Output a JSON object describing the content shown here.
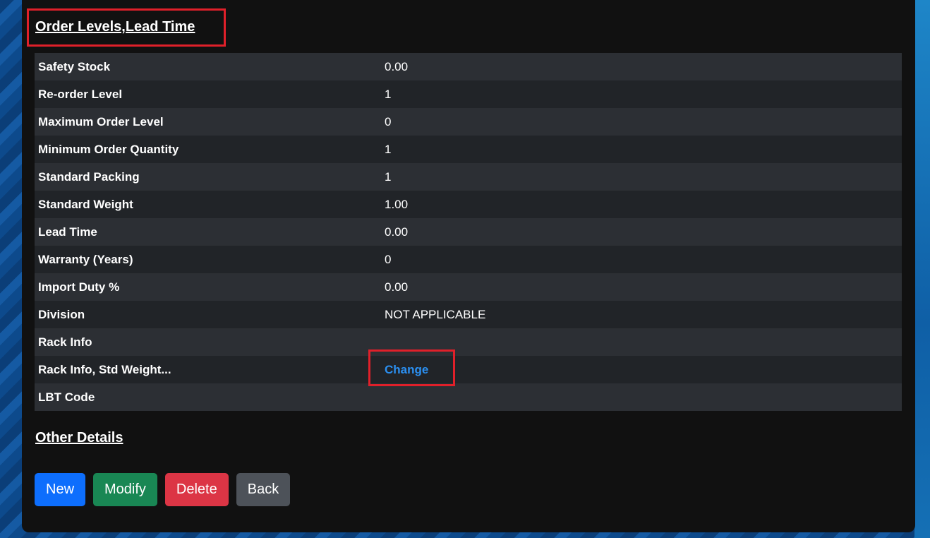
{
  "sections": {
    "order_levels_title": "Order Levels,Lead Time",
    "other_details_title": "Other Details"
  },
  "rows": [
    {
      "label": "Safety Stock",
      "value": "0.00"
    },
    {
      "label": "Re-order Level",
      "value": "1"
    },
    {
      "label": "Maximum Order Level",
      "value": "0"
    },
    {
      "label": "Minimum Order Quantity",
      "value": "1"
    },
    {
      "label": "Standard Packing",
      "value": "1"
    },
    {
      "label": "Standard Weight",
      "value": "1.00"
    },
    {
      "label": "Lead Time",
      "value": "0.00"
    },
    {
      "label": "Warranty (Years)",
      "value": "0"
    },
    {
      "label": "Import Duty %",
      "value": "0.00"
    },
    {
      "label": "Division",
      "value": "NOT APPLICABLE"
    },
    {
      "label": "Rack Info",
      "value": ""
    },
    {
      "label": "Rack Info, Std Weight...",
      "link": "Change"
    },
    {
      "label": "LBT Code",
      "value": ""
    }
  ],
  "buttons": {
    "new": "New",
    "modify": "Modify",
    "delete": "Delete",
    "back": "Back"
  },
  "colors": {
    "highlight": "#e0202a",
    "link": "#2b8ff0",
    "new": "#0d6efd",
    "modify": "#198754",
    "delete": "#dc3545",
    "back": "#4d5259"
  }
}
